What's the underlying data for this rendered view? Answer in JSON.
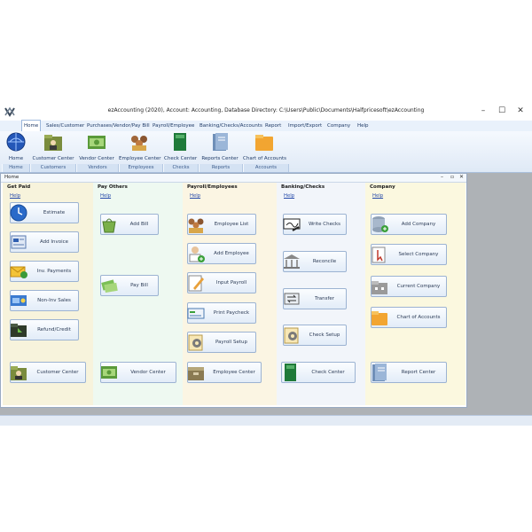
{
  "window": {
    "title": "ezAccounting (2020), Account: Accounting, Database Directory: C:\\Users\\Public\\Documents\\Halfpricesoft\\ezAccounting",
    "minimize": "–",
    "maximize": "☐",
    "close": "✕"
  },
  "menu": [
    "Home",
    "Sales/Customer",
    "Purchases/Vendor/Pay Bill",
    "Payroll/Employee",
    "Banking/Checks/Accounts",
    "Report",
    "Import/Export",
    "Company",
    "Help"
  ],
  "ribbon": {
    "buttons": [
      "Home",
      "Customer Center",
      "Vendor Center",
      "Employee Center",
      "Check Center",
      "Reports Center",
      "Chart of Accounts"
    ],
    "groups": [
      "Home",
      "Customers",
      "Vendors",
      "Employees",
      "Checks",
      "Reports",
      "Accounts"
    ]
  },
  "child": {
    "title": "Home",
    "minimize": "–",
    "restore": "▫",
    "close": "✕"
  },
  "help_label": "Help",
  "columns": {
    "get_paid": {
      "heading": "Get Paid",
      "buttons": [
        "Estimate",
        "Add Invoice",
        "Inv. Payments",
        "Non-Inv Sales",
        "Refund/Credit",
        "Customer Center"
      ]
    },
    "pay_others": {
      "heading": "Pay Others",
      "buttons": [
        "Add Bill",
        "Pay Bill",
        "Vendor Center"
      ]
    },
    "payroll": {
      "heading": "Payroll/Employees",
      "buttons": [
        "Employee List",
        "Add Employee",
        "Input Payroll",
        "Print Paycheck",
        "Payroll Setup",
        "Employee Center"
      ]
    },
    "banking": {
      "heading": "Banking/Checks",
      "buttons": [
        "Write Checks",
        "Reconcile",
        "Transfer",
        "Check Setup",
        "Check Center"
      ]
    },
    "company": {
      "heading": "Company",
      "buttons": [
        "Add Company",
        "Select Company",
        "Current Company",
        "Chart of Accounts",
        "Report Center"
      ]
    }
  }
}
